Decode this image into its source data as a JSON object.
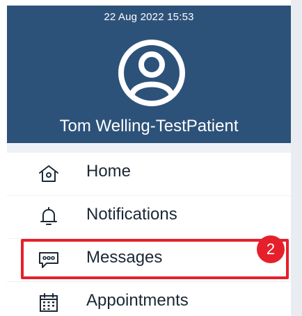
{
  "header": {
    "timestamp": "22 Aug 2022 15:53",
    "user_name": "Tom Welling-TestPatient",
    "avatar_icon": "user-circle-icon",
    "background_color": "#2d527a"
  },
  "menu": {
    "items": [
      {
        "label": "Home",
        "icon": "home-icon"
      },
      {
        "label": "Notifications",
        "icon": "bell-icon"
      },
      {
        "label": "Messages",
        "icon": "message-bubble-icon",
        "badge": "2",
        "highlighted": true
      },
      {
        "label": "Appointments",
        "icon": "calendar-icon"
      }
    ]
  },
  "colors": {
    "header": "#2d527a",
    "badge": "#e5202a",
    "highlight": "#e5202a",
    "text": "#1b2836"
  }
}
